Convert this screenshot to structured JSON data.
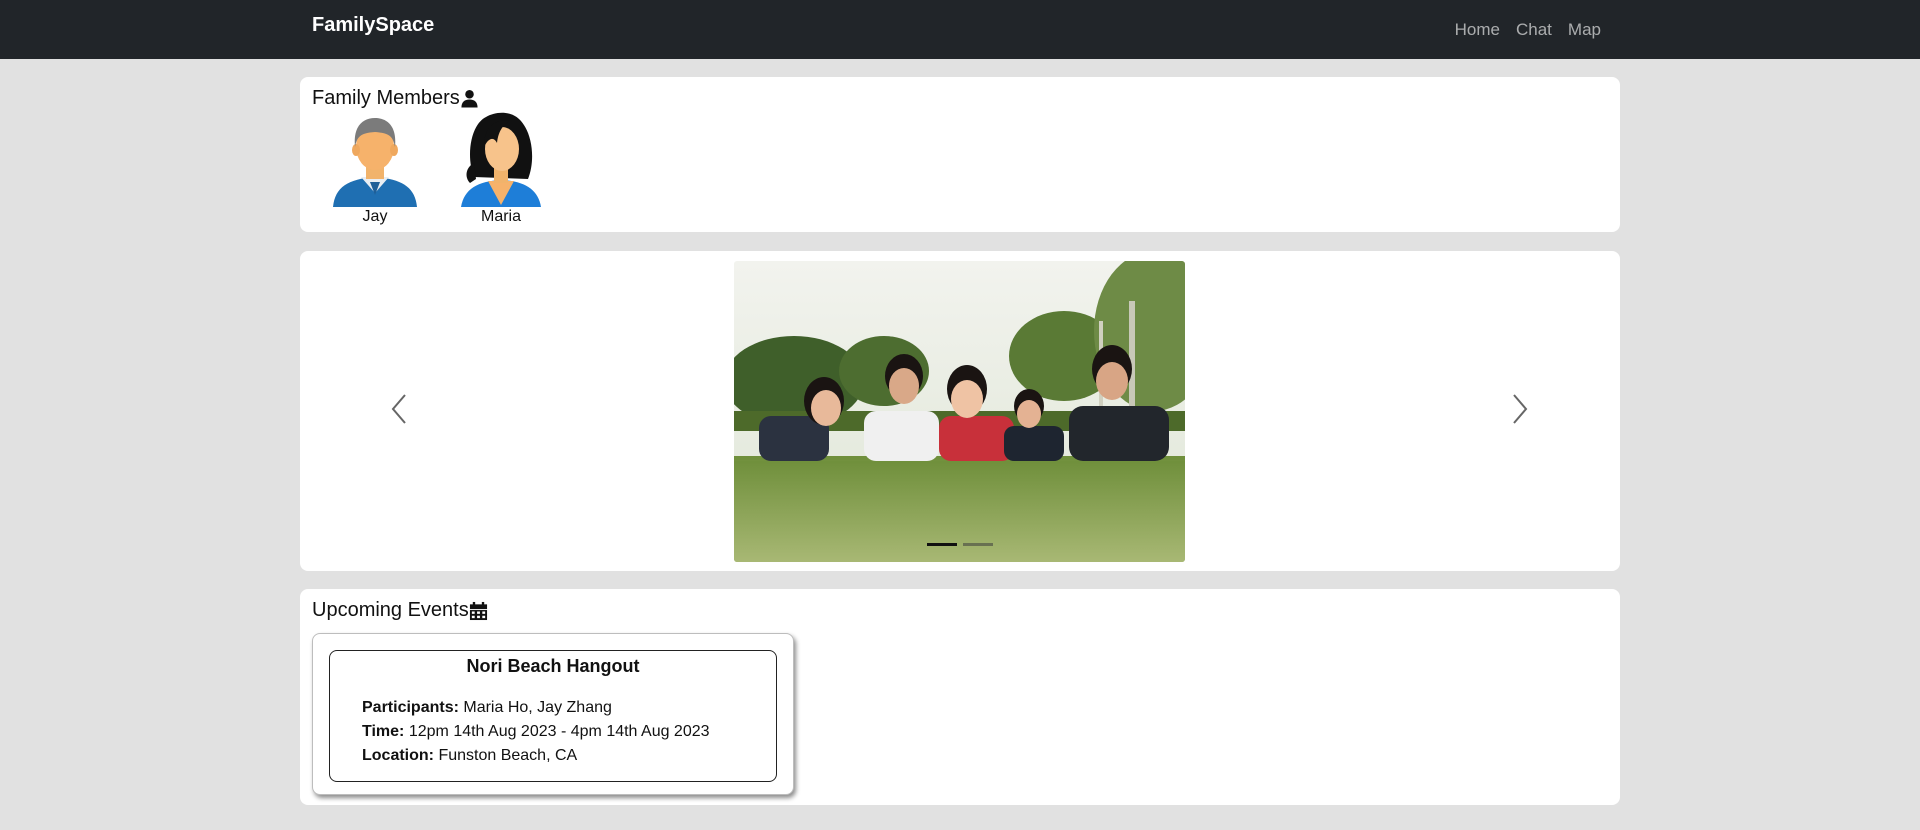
{
  "navbar": {
    "brand": "FamilySpace",
    "links": [
      "Home",
      "Chat",
      "Map"
    ]
  },
  "members_section": {
    "title": "Family Members",
    "icon": "user-icon",
    "members": [
      {
        "name": "Jay",
        "avatar": "male-avatar"
      },
      {
        "name": "Maria",
        "avatar": "female-avatar"
      }
    ]
  },
  "carousel": {
    "slide_image": "family-photo-on-grass",
    "slide_count": 2,
    "active_index": 0,
    "prev_icon": "chevron-left-icon",
    "next_icon": "chevron-right-icon"
  },
  "events_section": {
    "title": "Upcoming Events",
    "icon": "calendar-icon",
    "events": [
      {
        "title": "Nori Beach Hangout",
        "participants_label": "Participants:",
        "participants": "Maria Ho, Jay Zhang",
        "time_label": "Time:",
        "time": "12pm 14th Aug 2023 - 4pm 14th Aug 2023",
        "location_label": "Location:",
        "location": "Funston Beach, CA"
      }
    ]
  },
  "colors": {
    "navbar_bg": "#212529",
    "page_bg": "#e1e1e1",
    "card_bg": "#ffffff"
  }
}
